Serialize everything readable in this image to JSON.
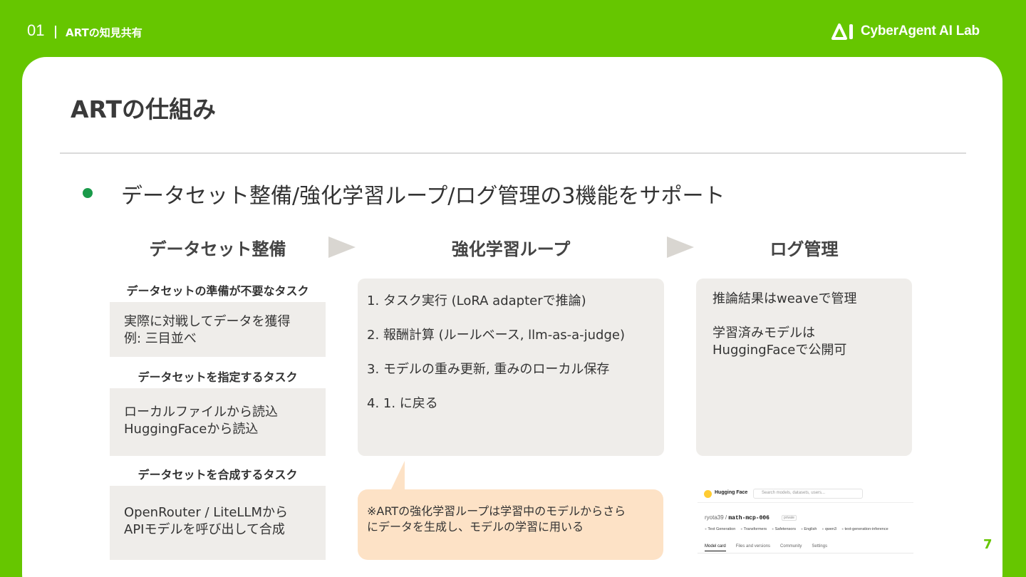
{
  "header": {
    "section_number": "01",
    "section_title": "ARTの知見共有",
    "logo_text": "CyberAgent AI Lab"
  },
  "slide": {
    "title": "ARTの仕組み",
    "bullet": "データセット整備/強化学習ループ/ログ管理の3機能をサポート",
    "page_number": "7"
  },
  "columns": {
    "dataset": {
      "heading": "データセット整備",
      "groups": [
        {
          "subhead": "データセットの準備が不要なタスク",
          "lines": [
            "実際に対戦してデータを獲得",
            "例: 三目並べ"
          ]
        },
        {
          "subhead": "データセットを指定するタスク",
          "lines": [
            "ローカルファイルから読込",
            "HuggingFaceから読込"
          ]
        },
        {
          "subhead": "データセットを合成するタスク",
          "lines": [
            "OpenRouter / LiteLLMから",
            "APIモデルを呼び出して合成"
          ]
        }
      ]
    },
    "loop": {
      "heading": "強化学習ループ",
      "items": [
        "1. タスク実行 (LoRA adapterで推論)",
        "2. 報酬計算 (ルールベース, llm-as-a-judge)",
        "3. モデルの重み更新, 重みのローカル保存",
        "4. 1. に戻る"
      ],
      "note_lines": [
        "※ARTの強化学習ループは学習中のモデルからさら",
        "にデータを生成し、モデルの学習に用いる"
      ]
    },
    "log": {
      "heading": "ログ管理",
      "lines": [
        "推論結果はweaveで管理",
        "",
        "学習済みモデルは",
        "HuggingFaceで公開可"
      ]
    }
  },
  "hf_screenshot": {
    "brand": "Hugging Face",
    "search_placeholder": "Search models, datasets, users...",
    "owner": "ryota39",
    "repo": "math-mcp-006",
    "visibility": "private",
    "tags": [
      "Text Generation",
      "Transformers",
      "Safetensors",
      "English",
      "qwen3",
      "text-generation-inference"
    ],
    "tabs": [
      "Model card",
      "Files and versions",
      "Community",
      "Settings"
    ]
  },
  "colors": {
    "brand_green": "#66c600",
    "bullet_green": "#1a9a4a",
    "box_gray": "#efedea",
    "callout_peach": "#fde2c6"
  }
}
